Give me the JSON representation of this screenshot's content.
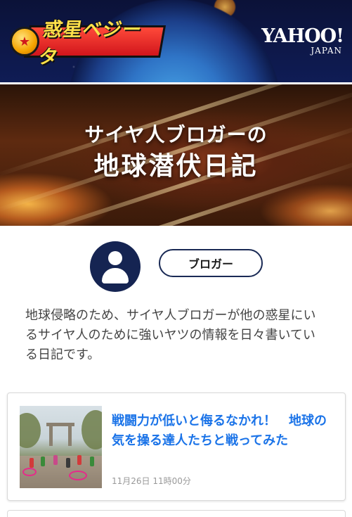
{
  "header": {
    "logo_badge": "★",
    "logo_text": "惑星ベジータ",
    "yahoo_main": "YAHOO!",
    "yahoo_sub": "JAPAN"
  },
  "hero": {
    "title_line1": "サイヤ人ブロガーの",
    "title_line2": "地球潜伏日記"
  },
  "profile": {
    "avatar_icon": "user-icon",
    "role_button_label": "ブロガー"
  },
  "description": "地球侵略のため、サイヤ人ブロガーが他の惑星にいるサイヤ人のために強いヤツの情報を日々書いている日記です。",
  "articles": [
    {
      "title": "戦闘力が低いと侮るなかれ！　地球の気を操る達人たちと戦ってみた",
      "time": "11月26日 11時00分",
      "title_color": "#1a73e8"
    }
  ]
}
